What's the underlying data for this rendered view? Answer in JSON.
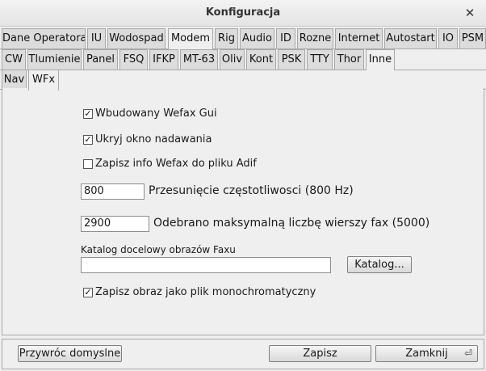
{
  "window": {
    "title": "Konfiguracja"
  },
  "tabs_row1": [
    "Dane Operatora",
    "IU",
    "Wodospad",
    "Modem",
    "Rig",
    "Audio",
    "ID",
    "Rozne",
    "Internet",
    "Autostart",
    "IO",
    "PSM"
  ],
  "tabs_row2": [
    "CW",
    "Tlumienie",
    "Panel",
    "FSQ",
    "IFKP",
    "MT-63",
    "Oliv",
    "Kont",
    "PSK",
    "TTY",
    "Thor",
    "Inne"
  ],
  "tabs_row3": [
    "Nav",
    "WFx"
  ],
  "active": {
    "row1": "Modem",
    "row2": "Inne",
    "row3": "WFx"
  },
  "wefax": {
    "builtin_gui": {
      "label": "Wbudowany Wefax Gui",
      "checked": true
    },
    "hide_tx_window": {
      "label": "Ukryj okno nadawania",
      "checked": true
    },
    "save_info_adif": {
      "label": "Zapisz info Wefax do pliku Adif",
      "checked": false
    },
    "freq_shift": {
      "value": "800",
      "label": "Przesunięcie częstotliwosci (800 Hz)"
    },
    "max_rows": {
      "value": "2900",
      "label": "Odebrano maksymalną liczbę wierszy fax (5000)"
    },
    "dest_dir": {
      "label": "Katalog docelowy obrazów Faxu",
      "value": "",
      "browse_label": "Katalog..."
    },
    "save_mono": {
      "label": "Zapisz obraz jako plik monochromatyczny",
      "checked": true
    }
  },
  "footer": {
    "restore_defaults": "Przywróc domyslne",
    "save": "Zapisz",
    "close": "Zamknij"
  }
}
